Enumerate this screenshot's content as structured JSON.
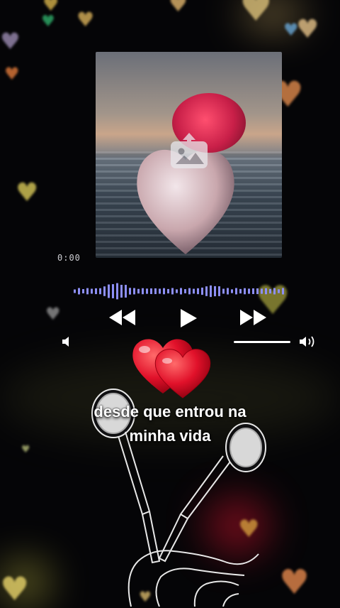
{
  "player": {
    "elapsed_time": "0:00",
    "lyric_line_1": "desde que entrou na",
    "lyric_line_2": "minha vida",
    "volume_level": 0.85,
    "progress": 0.0
  },
  "colors": {
    "background": "#050507",
    "waveform": "#8d8ff5",
    "controls": "#ffffff",
    "heart_red": "#e1112a"
  },
  "icons": {
    "upload_image": "image-upload-icon",
    "prev": "rewind-icon",
    "play": "play-icon",
    "next": "fast-forward-icon",
    "volume_low": "volume-low-icon",
    "volume_high": "volume-high-icon",
    "hearts": "two-hearts-emoji",
    "earphones": "earphones-illustration"
  }
}
